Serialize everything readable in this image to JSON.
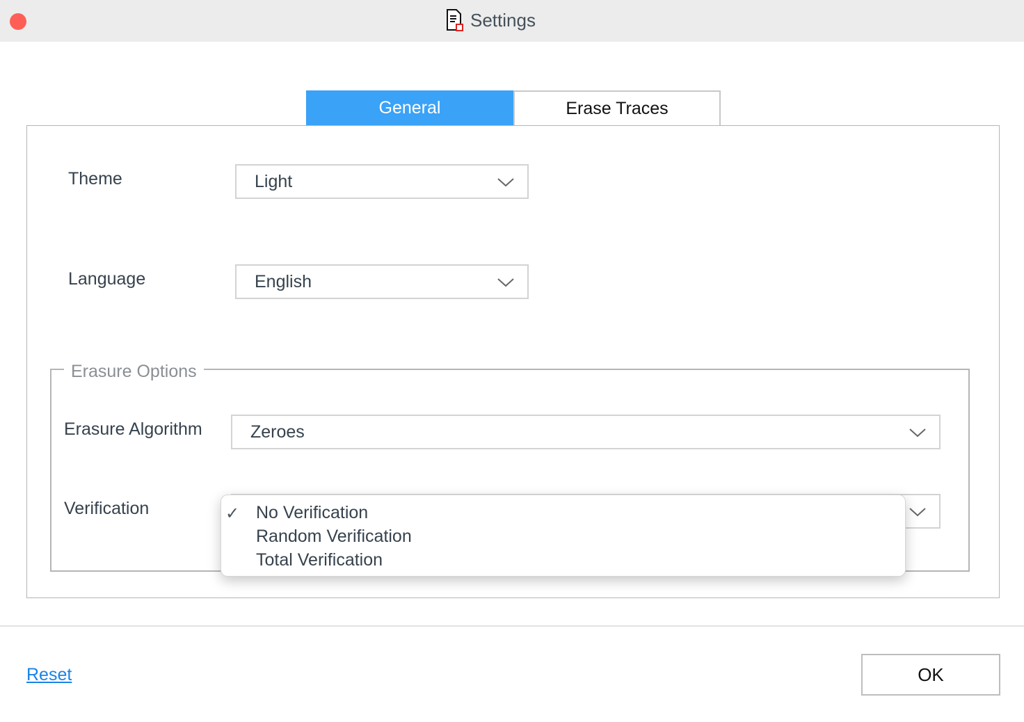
{
  "window": {
    "title": "Settings",
    "icon": "document-shield-icon"
  },
  "tabs": [
    {
      "label": "General",
      "active": true
    },
    {
      "label": "Erase Traces",
      "active": false
    }
  ],
  "general": {
    "theme": {
      "label": "Theme",
      "value": "Light"
    },
    "language": {
      "label": "Language",
      "value": "English"
    },
    "erasure_options": {
      "legend": "Erasure Options",
      "algorithm": {
        "label": "Erasure Algorithm",
        "value": "Zeroes"
      },
      "verification": {
        "label": "Verification",
        "options": [
          "No Verification",
          "Random Verification",
          "Total Verification"
        ],
        "selected": "No Verification"
      }
    }
  },
  "footer": {
    "reset_label": "Reset",
    "ok_label": "OK"
  },
  "colors": {
    "accent": "#3aa2f7",
    "link": "#1a82e6",
    "close": "#fd5f57"
  }
}
